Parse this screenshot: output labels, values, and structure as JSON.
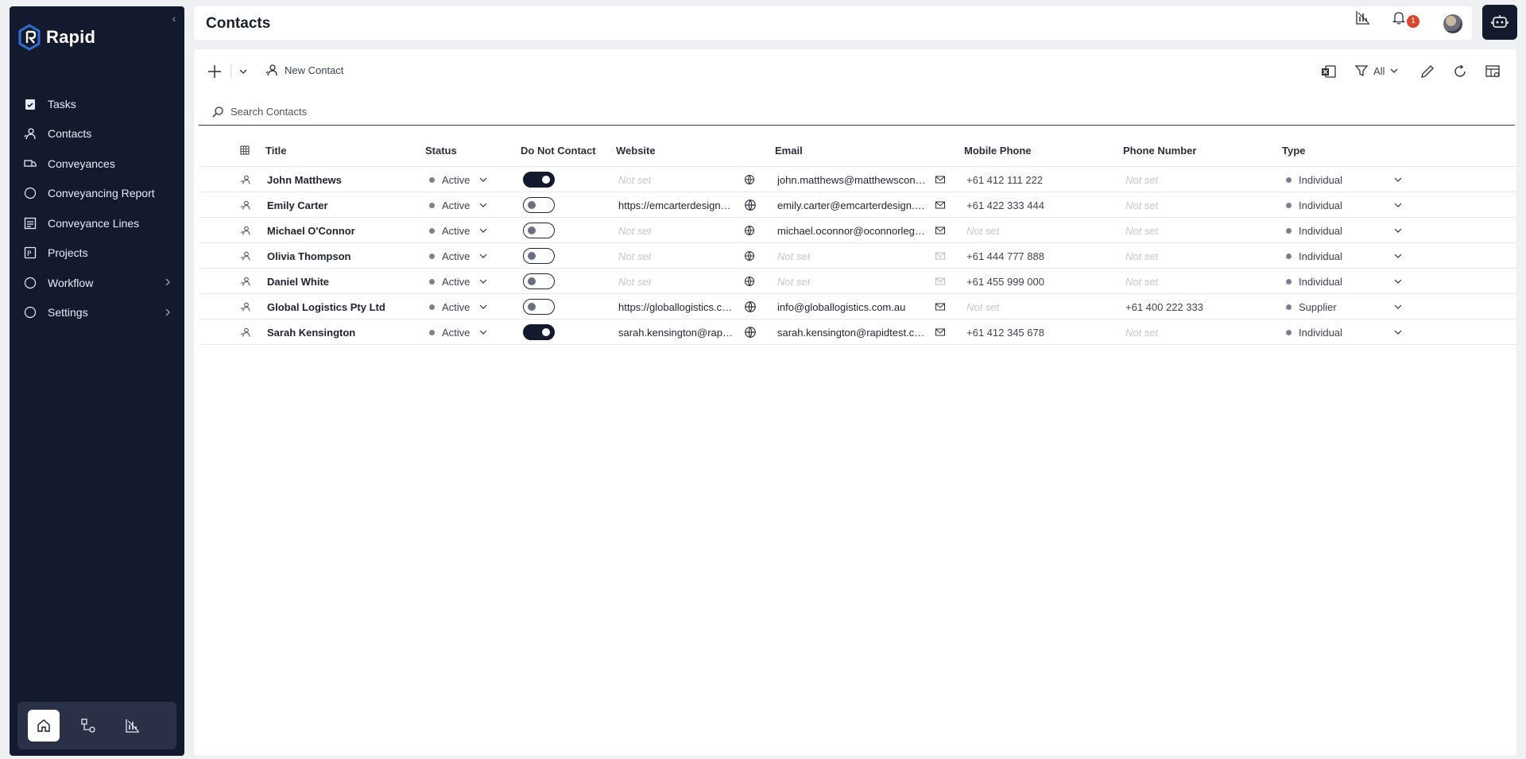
{
  "brand": {
    "name": "Rapid"
  },
  "sidebar": {
    "items": [
      {
        "label": "Tasks",
        "icon": "clipboard-check-icon"
      },
      {
        "label": "Contacts",
        "icon": "contact-icon"
      },
      {
        "label": "Conveyances",
        "icon": "truck-icon"
      },
      {
        "label": "Conveyancing Report",
        "icon": "circle-icon"
      },
      {
        "label": "Conveyance Lines",
        "icon": "report-lines-icon"
      },
      {
        "label": "Projects",
        "icon": "projects-icon"
      },
      {
        "label": "Workflow",
        "icon": "circle-icon",
        "has_children": true
      },
      {
        "label": "Settings",
        "icon": "circle-icon",
        "has_children": true
      }
    ],
    "dock": [
      "home-icon",
      "workflow-diagram-icon",
      "chart-icon"
    ]
  },
  "header": {
    "title": "Contacts",
    "notification_count": "1"
  },
  "toolbar": {
    "new_label": "New Contact",
    "filter_label": "All"
  },
  "search": {
    "placeholder": "Search Contacts"
  },
  "table": {
    "columns": [
      "Title",
      "Status",
      "Do Not Contact",
      "Website",
      "Email",
      "Mobile Phone",
      "Phone Number",
      "Type"
    ],
    "not_set": "Not set",
    "rows": [
      {
        "title": "John Matthews",
        "status": "Active",
        "do_not_contact": true,
        "website": "",
        "email": "john.matthews@matthewsconsulting.com.au",
        "mobile": "+61 412 111 222",
        "phone": "",
        "type": "Individual"
      },
      {
        "title": "Emily Carter",
        "status": "Active",
        "do_not_contact": false,
        "website": "https://emcarterdesign.com.au",
        "email": "emily.carter@emcarterdesign.com.au",
        "mobile": "+61 422 333 444",
        "phone": "",
        "type": "Individual"
      },
      {
        "title": "Michael O'Connor",
        "status": "Active",
        "do_not_contact": false,
        "website": "",
        "email": "michael.oconnor@oconnorlegal.com.au",
        "mobile": "",
        "phone": "",
        "type": "Individual"
      },
      {
        "title": "Olivia Thompson",
        "status": "Active",
        "do_not_contact": false,
        "website": "",
        "email": "",
        "mobile": "+61 444 777 888",
        "phone": "",
        "type": "Individual"
      },
      {
        "title": "Daniel White",
        "status": "Active",
        "do_not_contact": false,
        "website": "",
        "email": "",
        "mobile": "+61 455 999 000",
        "phone": "",
        "type": "Individual"
      },
      {
        "title": "Global Logistics Pty Ltd",
        "status": "Active",
        "do_not_contact": false,
        "website": "https://globallogistics.com.au",
        "email": "info@globallogistics.com.au",
        "mobile": "",
        "phone": "+61 400 222 333",
        "type": "Supplier"
      },
      {
        "title": "Sarah Kensington",
        "status": "Active",
        "do_not_contact": true,
        "website": "sarah.kensington@rapidtest.com.au",
        "email": "sarah.kensington@rapidtest.com.au",
        "mobile": "+61 412 345 678",
        "phone": "",
        "type": "Individual"
      }
    ]
  },
  "colors": {
    "sidebar_bg": "#141a2e",
    "badge": "#d9452b",
    "accent": "#2f6fd6"
  }
}
